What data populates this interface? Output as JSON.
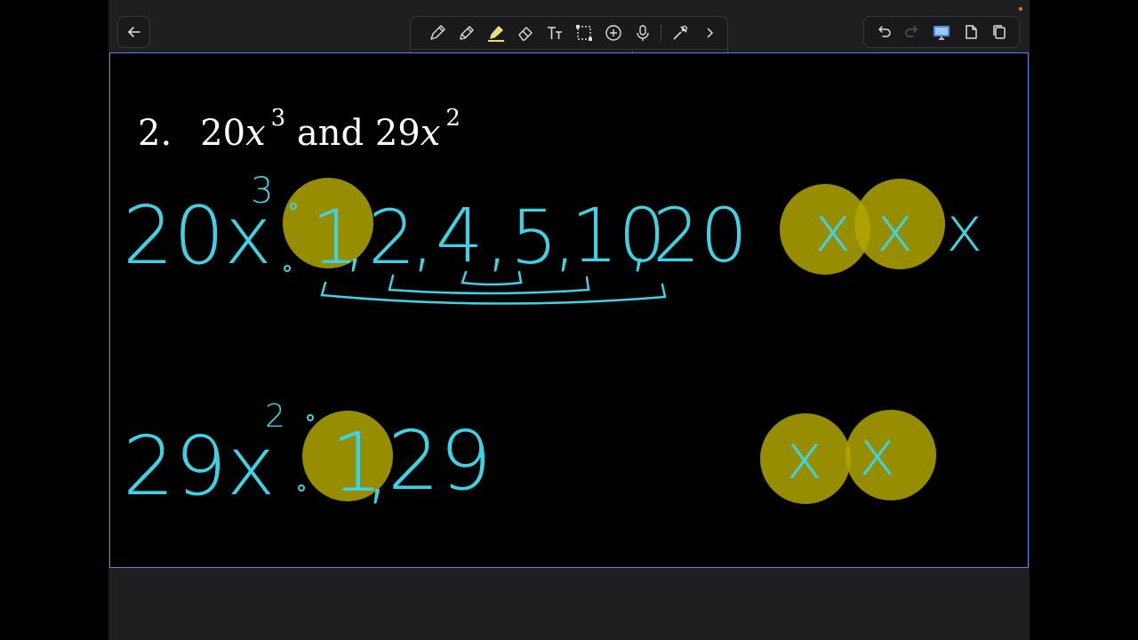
{
  "topbar": {
    "back_icon": "arrow-left-icon",
    "actions": [
      "undo-icon",
      "redo-icon",
      "present-icon",
      "share-icon",
      "copy-icon"
    ]
  },
  "toolbar": {
    "tools": [
      "pen-icon",
      "pencil-icon",
      "highlighter-icon",
      "eraser-icon",
      "text-icon",
      "lasso-icon",
      "shapes-icon",
      "microphone-icon",
      "laser-icon",
      "chevron-right-icon"
    ],
    "colors": [
      "#f7e91b",
      "#1fc4da",
      "#4fdf6a",
      "#ffffff",
      "#e21fd9"
    ],
    "selected_color": "#f7e91b",
    "add_color_label": "+"
  },
  "problem": {
    "number": "2.",
    "term1": "20",
    "term1_var": "x",
    "term1_exp": "3",
    "connector": "and",
    "term2": "29",
    "term2_var": "x",
    "term2_exp": "2"
  },
  "handwriting": {
    "row1_term": "20x",
    "row1_exp": "3",
    "row1_factors": [
      "1",
      "2",
      "4",
      "5",
      "10",
      "20"
    ],
    "row1_x_marks": [
      "x",
      "x",
      "x"
    ],
    "row2_term": "29x",
    "row2_exp": "2",
    "row2_factors": [
      "1",
      "29"
    ],
    "row2_x_marks": [
      "x",
      "x"
    ],
    "ink_color": "#3fd2e4",
    "highlight_color": "#b1a600"
  }
}
